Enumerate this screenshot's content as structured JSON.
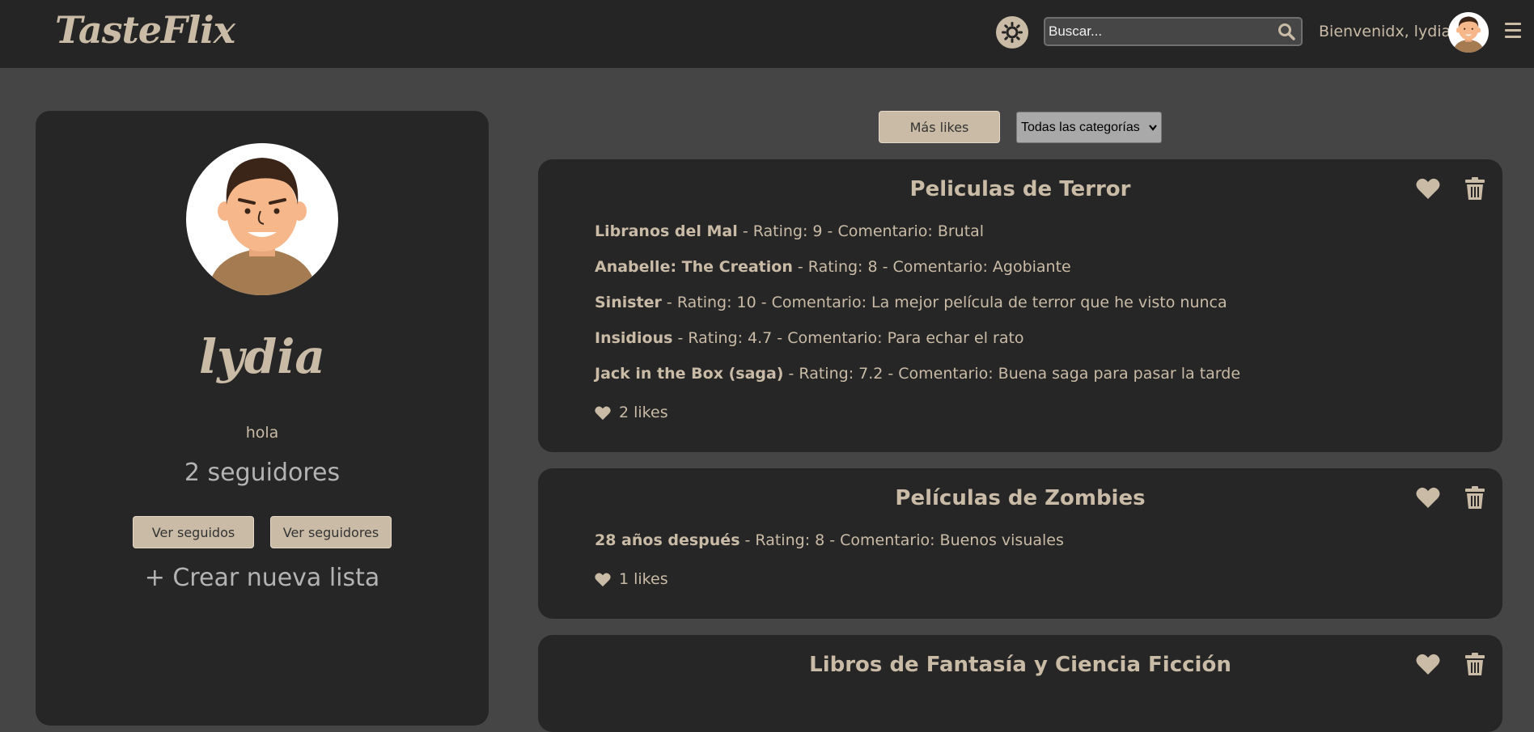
{
  "header": {
    "logo": "TasteFlix",
    "search_placeholder": "Buscar...",
    "welcome": "Bienvenidx, lydia"
  },
  "profile": {
    "name": "lydia",
    "bio": "hola",
    "followers": "2 seguidores",
    "following_button": "Ver seguidos",
    "followers_button": "Ver seguidores",
    "create_list": "+ Crear nueva lista"
  },
  "filters": {
    "sort_label": "Más likes",
    "category_selected": "Todas las categorías"
  },
  "lists": [
    {
      "title": "Peliculas de Terror",
      "items": [
        {
          "name": "Libranos del Mal",
          "details": " - Rating: 9 - Comentario: Brutal"
        },
        {
          "name": "Anabelle: The Creation",
          "details": " - Rating: 8 - Comentario: Agobiante"
        },
        {
          "name": "Sinister",
          "details": " - Rating: 10 - Comentario: La mejor película de terror que he visto nunca"
        },
        {
          "name": "Insidious",
          "details": " - Rating: 4.7 - Comentario: Para echar el rato"
        },
        {
          "name": "Jack in the Box (saga)",
          "details": " - Rating: 7.2 - Comentario: Buena saga para pasar la tarde"
        }
      ],
      "likes": "2 likes"
    },
    {
      "title": "Películas de Zombies",
      "items": [
        {
          "name": "28 años después",
          "details": " - Rating: 8 - Comentario: Buenos visuales"
        }
      ],
      "likes": "1 likes"
    },
    {
      "title": "Libros de Fantasía y Ciencia Ficción",
      "items": [],
      "likes": ""
    }
  ],
  "colors": {
    "accent": "#c9bba6",
    "header_bg": "#252525",
    "page_bg": "#454545",
    "card_bg": "#262626"
  },
  "icons": {
    "theme": "sun-icon",
    "search": "search-icon",
    "menu": "hamburger-menu-icon",
    "like": "heart-icon",
    "delete": "trash-icon"
  }
}
